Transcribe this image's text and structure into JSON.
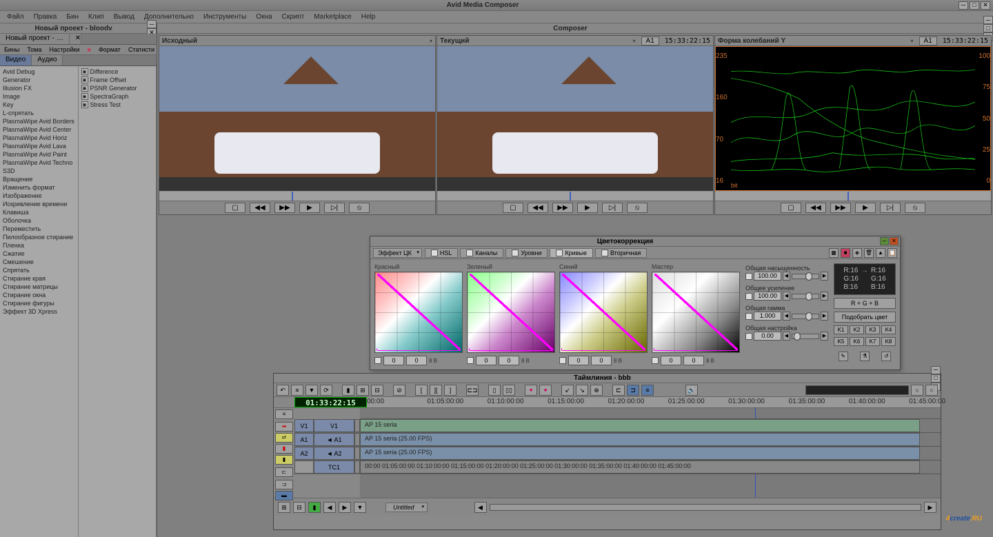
{
  "app_title": "Avid Media Composer",
  "menu": [
    "Файл",
    "Правка",
    "Бин",
    "Клип",
    "Вывод",
    "Дополнительно",
    "Инструменты",
    "Окна",
    "Скрипт",
    "Marketplace",
    "Help"
  ],
  "project": {
    "title": "Новый проект - bloodv",
    "tab": "Новый проект - …",
    "toolbar": [
      "Бины",
      "Тома",
      "Настройки",
      "■",
      "Формат",
      "Статисти"
    ],
    "subtabs": [
      "Видео",
      "Аудио"
    ]
  },
  "effects_left": [
    "Avid Debug",
    "Generator",
    "Illusion FX",
    "Image",
    "Key",
    "L-спрятать",
    "PlasmaWipe Avid Borders",
    "PlasmaWipe Avid Center",
    "PlasmaWipe Avid Horiz",
    "PlasmaWipe Avid Lava",
    "PlasmaWipe Avid Paint",
    "PlasmaWipe Avid Techno",
    "S3D",
    "Вращение",
    "Изменить формат",
    "Изображение",
    "Искривление времени",
    "Клавиша",
    "Оболочка",
    "Переместить",
    "Пилообразное стирание",
    "Пленка",
    "Сжатие",
    "Смешение",
    "Спрятать",
    "Стирание края",
    "Стирание матрицы",
    "Стирание окна",
    "Стирание фигуры",
    "Эффект 3D Xpress"
  ],
  "effects_right": [
    "Difference",
    "Frame Offset",
    "PSNR Generator",
    "SpectraGraph",
    "Stress Test"
  ],
  "composer": {
    "title": "Composer",
    "left_label": "Исходный",
    "right_label": "Текущий",
    "wave_label": "Форма колебаний Y",
    "track_badge": "A1",
    "timecode": "15:33:22:15",
    "scale_left": [
      "235",
      "160",
      "70",
      "16"
    ],
    "scale_right": [
      "100",
      "75",
      "50",
      "25",
      "0"
    ],
    "scale_unit": "bit"
  },
  "transport_icons": [
    "▢",
    "◀◀",
    "▶▶",
    "▶",
    "▷|",
    "⦸"
  ],
  "colorcorr": {
    "title": "Цветокоррекция",
    "effect_drop": "Эффект ЦК",
    "tabs": [
      "HSL",
      "Каналы",
      "Уровни",
      "Кривые",
      "Вторичная"
    ],
    "active_tab": 3,
    "curves": [
      "Красный",
      "Зеленый",
      "Синий",
      "Мастер"
    ],
    "curve_value": "0",
    "curve_unit": "8 В",
    "sliders": [
      {
        "label": "Общая насыщенность",
        "value": "100.00",
        "pos": 50
      },
      {
        "label": "Общее усиление",
        "value": "100.00",
        "pos": 50
      },
      {
        "label": "Общая гамма",
        "value": "1.000",
        "pos": 50
      },
      {
        "label": "Общая настройка",
        "value": "0.00",
        "pos": 5
      }
    ],
    "rgb_info": {
      "r": "R:16",
      "g": "G:16",
      "b": "B:16"
    },
    "btn_rgb": "R + G + B",
    "btn_match": "Подобрать цвет",
    "kbtns": [
      "K1",
      "K2",
      "K3",
      "K4",
      "K5",
      "K6",
      "K7",
      "K8"
    ]
  },
  "timeline": {
    "title": "Таймлиния - bbb",
    "current_tc": "01:33:22:15",
    "ruler": [
      "00:00",
      "01:05:00:00",
      "01:10:00:00",
      "01:15:00:00",
      "01:20:00:00",
      "01:25:00:00",
      "01:30:00:00",
      "01:35:00:00",
      "01:40:00:00",
      "01:45:00:00"
    ],
    "tracks": [
      {
        "h1": "V1",
        "h2": "V1",
        "clip": "AP 15 seria",
        "style": "green"
      },
      {
        "h1": "A1",
        "h2": "◄ A1",
        "clip": "AP 15 seria (25.00 FPS)",
        "style": "blue"
      },
      {
        "h1": "A2",
        "h2": "◄ A2",
        "clip": "AP 15 seria (25.00 FPS)",
        "style": "blue"
      },
      {
        "h1": "",
        "h2": "TC1",
        "clip": "00:00       01:05:00:00       01:10:00:00       01:15:00:00       01:20:00:00       01:25:00:00       01:30:00:00       01:35:00:00       01:40:00:00       01:45:00:00",
        "style": "tc"
      }
    ],
    "bottom_drop": "Untitled"
  },
  "watermark": {
    "a": "4",
    "b": "create",
    "c": ".RU"
  }
}
